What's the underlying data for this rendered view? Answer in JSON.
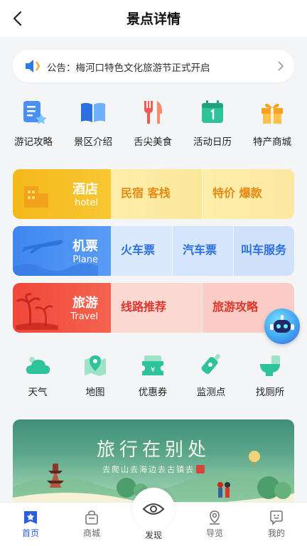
{
  "header": {
    "title": "景点详情"
  },
  "notice": {
    "text": "公告：梅河口特色文化旅游节正式开启"
  },
  "quick_links": [
    {
      "label": "游记攻略",
      "icon": "travel-notes-icon"
    },
    {
      "label": "景区介绍",
      "icon": "book-icon"
    },
    {
      "label": "舌尖美食",
      "icon": "fork-knife-icon"
    },
    {
      "label": "活动日历",
      "icon": "calendar-icon"
    },
    {
      "label": "特产商城",
      "icon": "gift-icon"
    }
  ],
  "hotel": {
    "title": "酒店",
    "subtitle": "hotel",
    "options": [
      "民宿 客栈",
      "特价 爆款"
    ]
  },
  "ticket": {
    "title": "机票",
    "subtitle": "Plane",
    "options": [
      "火车票",
      "汽车票",
      "叫车服务"
    ]
  },
  "travel": {
    "title": "旅游",
    "subtitle": "Travel",
    "options": [
      "线路推荐",
      "旅游攻略"
    ]
  },
  "tools": [
    {
      "label": "天气",
      "icon": "cloud-icon"
    },
    {
      "label": "地图",
      "icon": "map-pin-icon"
    },
    {
      "label": "优惠券",
      "icon": "coupon-icon"
    },
    {
      "label": "监测点",
      "icon": "sensor-icon"
    },
    {
      "label": "找厕所",
      "icon": "toilet-icon"
    }
  ],
  "banner": {
    "title": "旅行在别处",
    "subtitle": "去爬山去海边去古镇去"
  },
  "tabbar": [
    {
      "label": "首页",
      "icon": "home-star-icon",
      "active": true
    },
    {
      "label": "商城",
      "icon": "shopping-bag-icon"
    },
    {
      "label": "发现",
      "icon": "eye-icon"
    },
    {
      "label": "导览",
      "icon": "location-icon"
    },
    {
      "label": "我的",
      "icon": "profile-icon"
    }
  ],
  "colors": {
    "primary": "#2b5fd9",
    "hotel": "#f7c21e",
    "ticket": "#4a8ff3",
    "travel": "#f3594c",
    "tool": "#2fc39b"
  }
}
